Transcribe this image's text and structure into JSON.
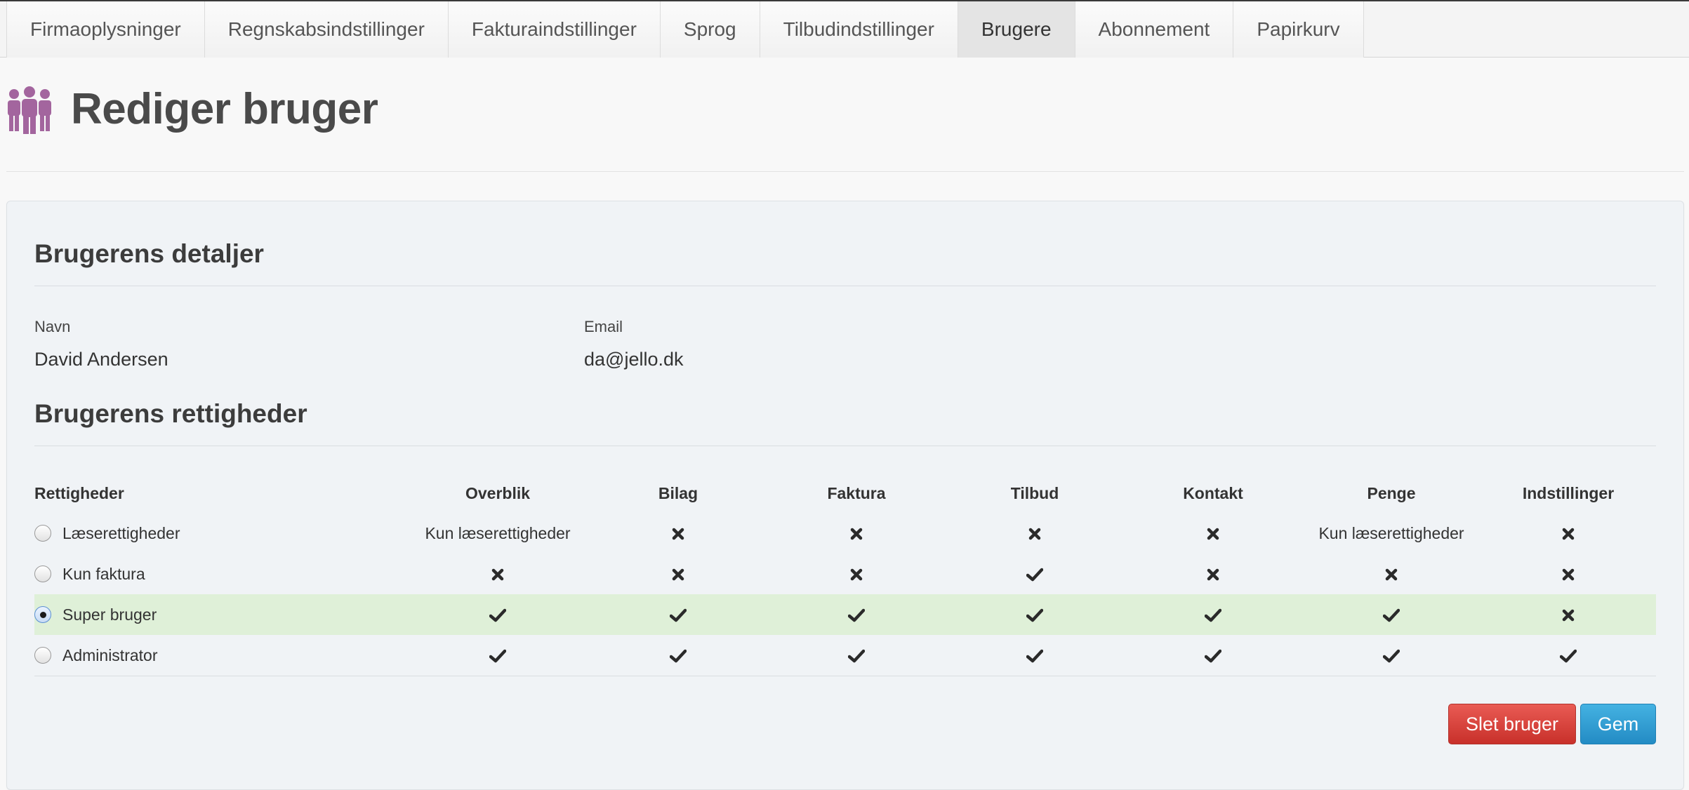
{
  "tabs": [
    {
      "label": "Firmaoplysninger",
      "active": false
    },
    {
      "label": "Regnskabsindstillinger",
      "active": false
    },
    {
      "label": "Fakturaindstillinger",
      "active": false
    },
    {
      "label": "Sprog",
      "active": false
    },
    {
      "label": "Tilbudindstillinger",
      "active": false
    },
    {
      "label": "Brugere",
      "active": true
    },
    {
      "label": "Abonnement",
      "active": false
    },
    {
      "label": "Papirkurv",
      "active": false
    }
  ],
  "header": {
    "title": "Rediger bruger",
    "icon": "users-icon",
    "icon_color": "#a3659e"
  },
  "details": {
    "title": "Brugerens detaljer",
    "name_label": "Navn",
    "name_value": "David Andersen",
    "email_label": "Email",
    "email_value": "da@jello.dk"
  },
  "permissions": {
    "title": "Brugerens rettigheder",
    "columns": [
      "Rettigheder",
      "Overblik",
      "Bilag",
      "Faktura",
      "Tilbud",
      "Kontakt",
      "Penge",
      "Indstillinger"
    ],
    "rows": [
      {
        "role": "Læserettigheder",
        "selected": false,
        "cells": [
          "Kun læserettigheder",
          "x",
          "x",
          "x",
          "x",
          "Kun læserettigheder",
          "x"
        ]
      },
      {
        "role": "Kun faktura",
        "selected": false,
        "cells": [
          "x",
          "x",
          "x",
          "check",
          "x",
          "x",
          "x"
        ]
      },
      {
        "role": "Super bruger",
        "selected": true,
        "cells": [
          "check",
          "check",
          "check",
          "check",
          "check",
          "check",
          "x"
        ]
      },
      {
        "role": "Administrator",
        "selected": false,
        "cells": [
          "check",
          "check",
          "check",
          "check",
          "check",
          "check",
          "check"
        ]
      }
    ]
  },
  "actions": {
    "delete_label": "Slet bruger",
    "save_label": "Gem"
  },
  "colors": {
    "danger": "#d9433c",
    "primary": "#2fa0d6",
    "selected_row": "#dff0d8"
  }
}
